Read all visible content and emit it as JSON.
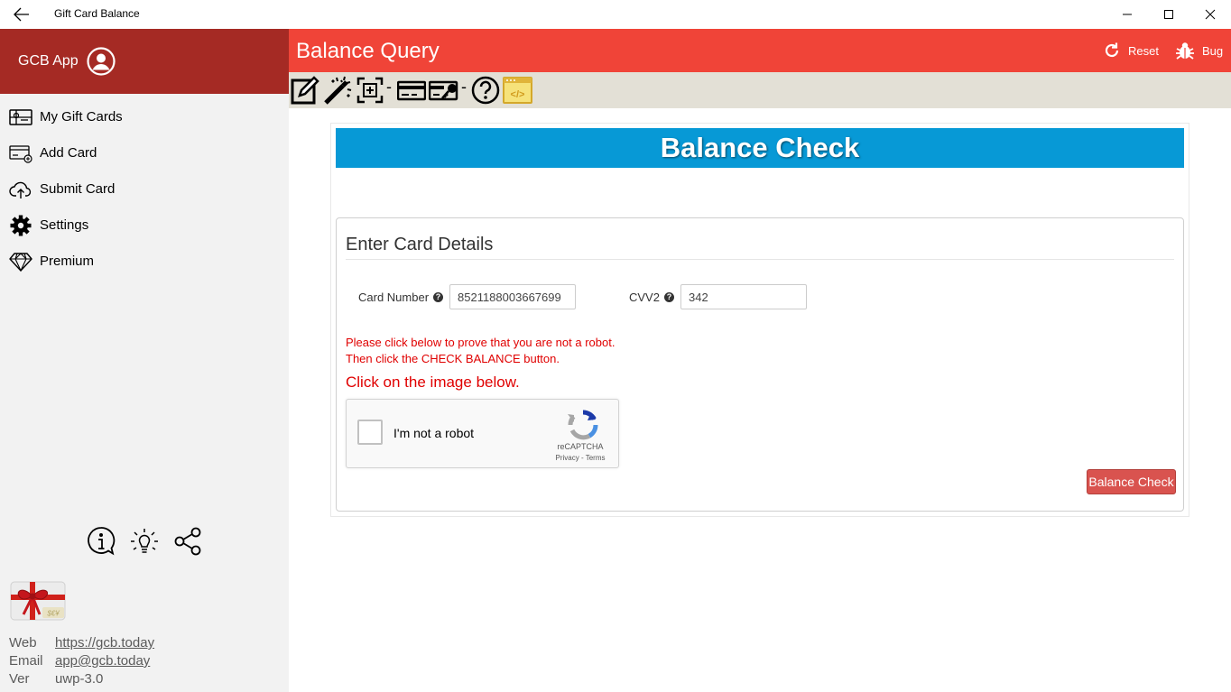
{
  "window": {
    "title": "Gift Card Balance"
  },
  "sidebar": {
    "app_name": "GCB App",
    "items": [
      {
        "label": "My Gift Cards",
        "icon": "gift-card-icon"
      },
      {
        "label": "Add Card",
        "icon": "add-card-icon"
      },
      {
        "label": "Submit Card",
        "icon": "cloud-upload-icon"
      },
      {
        "label": "Settings",
        "icon": "gear-icon"
      },
      {
        "label": "Premium",
        "icon": "diamond-icon"
      }
    ],
    "bottom_icons": [
      "info-icon",
      "lightbulb-icon",
      "share-icon"
    ],
    "info": {
      "web_label": "Web",
      "web_value": "https://gcb.today",
      "email_label": "Email",
      "email_value": "app@gcb.today",
      "ver_label": "Ver",
      "ver_value": "uwp-3.0"
    }
  },
  "header": {
    "title": "Balance Query",
    "reset_label": "Reset",
    "bug_label": "Bug"
  },
  "toolbar": {
    "icons": [
      "edit-icon",
      "magic-wand-icon",
      "select-region-icon",
      "card-icon",
      "card-key-icon",
      "help-icon",
      "code-icon"
    ],
    "separator": "-"
  },
  "content": {
    "banner": "Balance Check",
    "panel_title": "Enter Card Details",
    "card_number_label": "Card Number",
    "card_number_value": "8521188003667699",
    "cvv_label": "CVV2",
    "cvv_value": "342",
    "help_glyph": "?",
    "warn_line1": "Please click below to prove that you are not a robot.",
    "warn_line2": "Then click the CHECK BALANCE button.",
    "click_image": "Click on the image below.",
    "captcha_label": "I'm not a robot",
    "captcha_brand": "reCAPTCHA",
    "captcha_terms": "Privacy - Terms",
    "button_label": "Balance Check"
  },
  "colors": {
    "sidebar_header": "#a52a24",
    "main_header": "#f04438",
    "toolbar_bg": "#e3e0d6",
    "banner": "#0799d6",
    "warning": "#e00000",
    "button": "#d9534f"
  }
}
